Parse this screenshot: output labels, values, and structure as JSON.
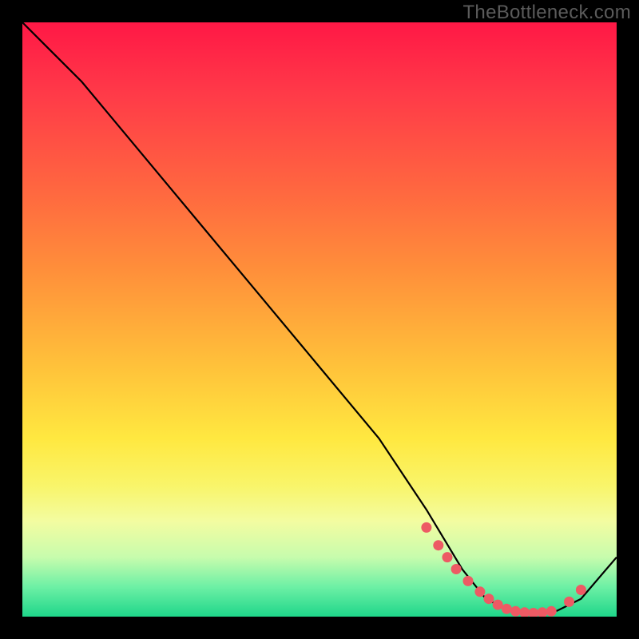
{
  "watermark": "TheBottleneck.com",
  "chart_data": {
    "type": "line",
    "title": "",
    "xlabel": "",
    "ylabel": "",
    "xlim": [
      0,
      100
    ],
    "ylim": [
      0,
      100
    ],
    "background_gradient": [
      "#ff1846",
      "#ff903a",
      "#ffe840",
      "#1fd68a"
    ],
    "series": [
      {
        "name": "curve",
        "color": "#000000",
        "x": [
          0,
          4,
          10,
          20,
          30,
          40,
          50,
          60,
          68,
          74,
          78,
          82,
          86,
          90,
          94,
          100
        ],
        "y": [
          100,
          96,
          90,
          78,
          66,
          54,
          42,
          30,
          18,
          8,
          3,
          1,
          0.5,
          1,
          3,
          10
        ]
      }
    ],
    "markers": {
      "color": "#ed5a64",
      "x": [
        68,
        70,
        71.5,
        73,
        75,
        77,
        78.5,
        80,
        81.5,
        83,
        84.5,
        86,
        87.5,
        89,
        92,
        94
      ],
      "y": [
        15,
        12,
        10,
        8,
        6,
        4.2,
        3,
        2,
        1.3,
        0.9,
        0.7,
        0.6,
        0.7,
        0.9,
        2.5,
        4.5
      ]
    }
  },
  "colors": {
    "curve": "#000000",
    "marker": "#ed5a64",
    "page_bg": "#000000"
  }
}
